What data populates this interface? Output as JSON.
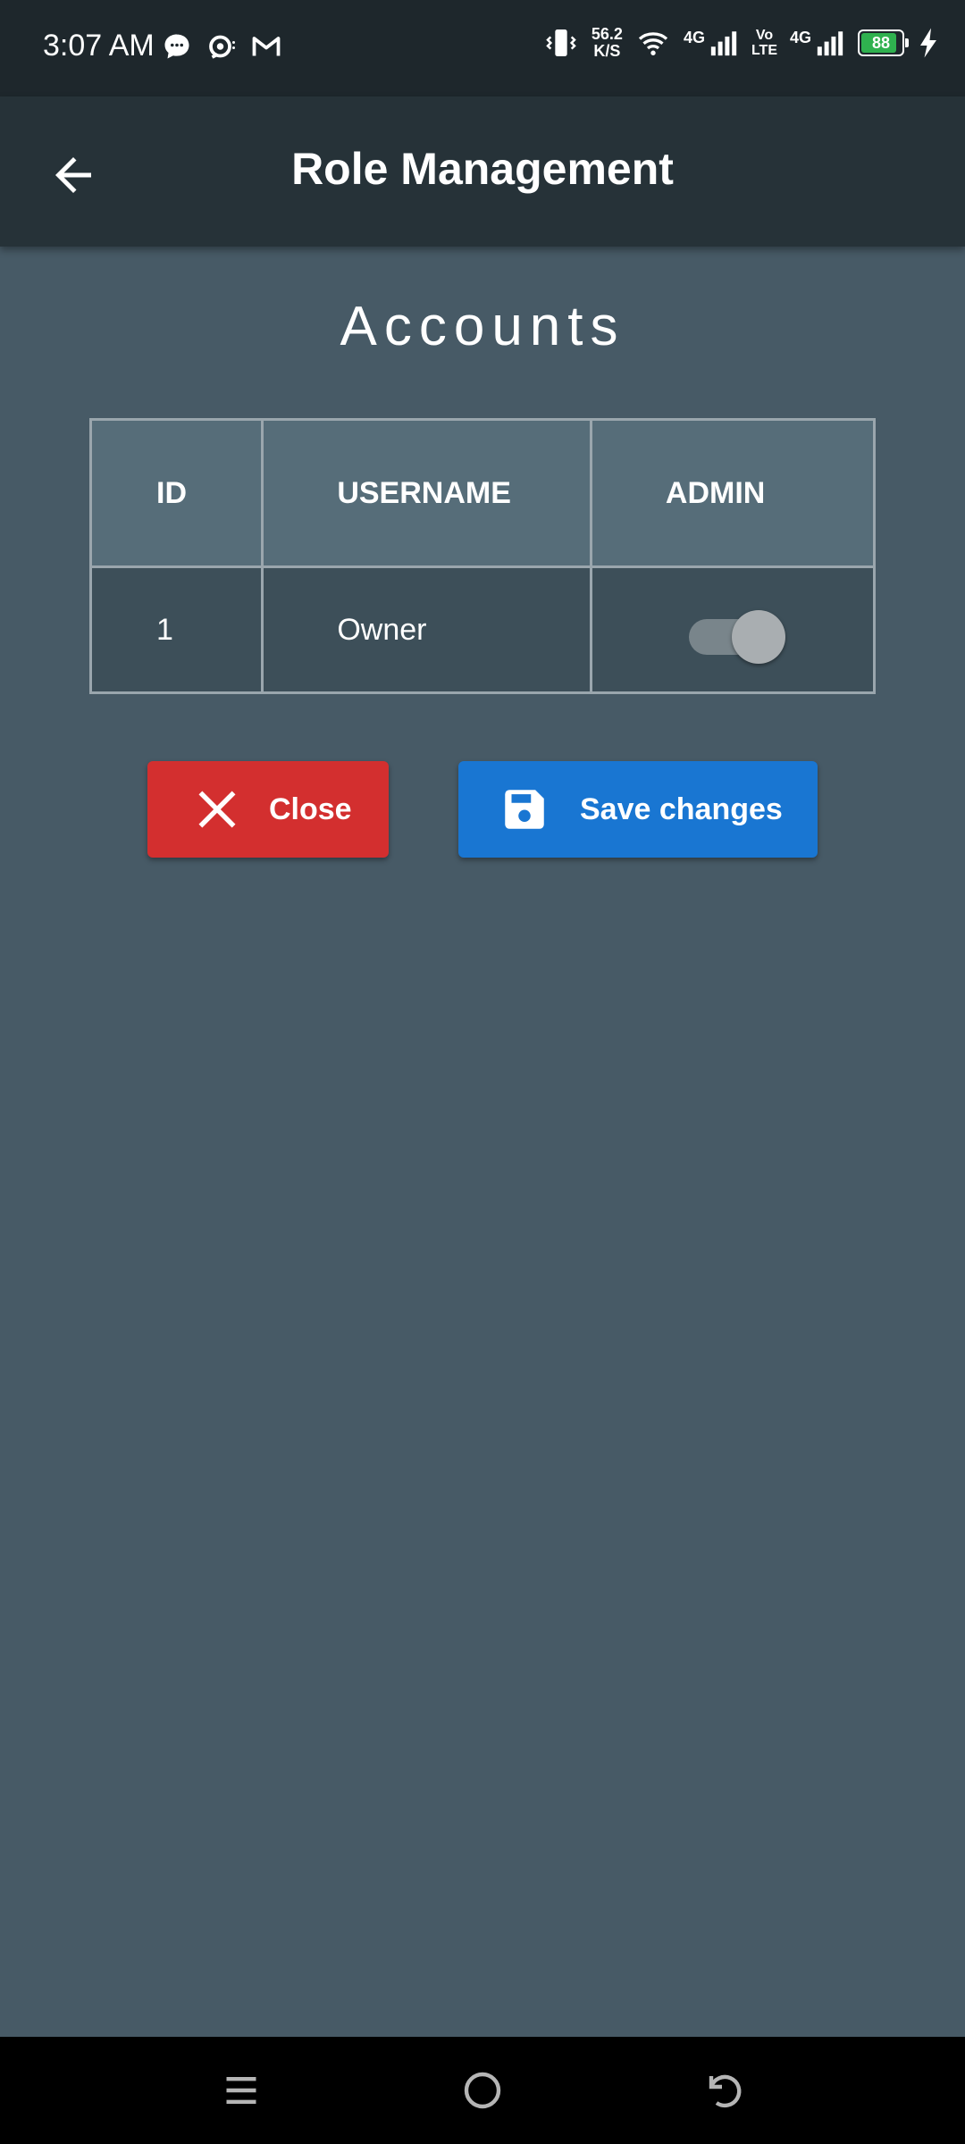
{
  "status_bar": {
    "time": "3:07 AM",
    "net_speed_value": "56.2",
    "net_speed_unit": "K/S",
    "volte_top": "Vo",
    "volte_bottom": "LTE",
    "sim1_type": "4G",
    "sim2_type": "4G",
    "battery_level": "88",
    "battery_fraction": 0.88,
    "icons": [
      "chat-bubble-icon",
      "sync-notification-icon",
      "gmail-icon",
      "vibrate-icon",
      "wifi-icon",
      "signal-icon",
      "charging-icon"
    ]
  },
  "app_bar": {
    "title": "Role Management",
    "back_icon": "arrow-left-icon"
  },
  "content": {
    "section_title": "Accounts",
    "table": {
      "headers": [
        "ID",
        "USERNAME",
        "ADMIN"
      ],
      "rows": [
        {
          "id": "1",
          "username": "Owner",
          "admin": false
        }
      ]
    }
  },
  "actions": {
    "close_label": "Close",
    "close_icon": "close-icon",
    "save_label": "Save changes",
    "save_icon": "floppy-disk-icon"
  },
  "colors": {
    "background": "#475a66",
    "app_bar": "#263238",
    "close_button": "#d32f2f",
    "save_button": "#1976d2",
    "table_header": "#566d79",
    "table_row": "#3d4f59"
  },
  "nav_bar": {
    "icons": [
      "menu-icon",
      "home-icon",
      "back-icon"
    ]
  }
}
